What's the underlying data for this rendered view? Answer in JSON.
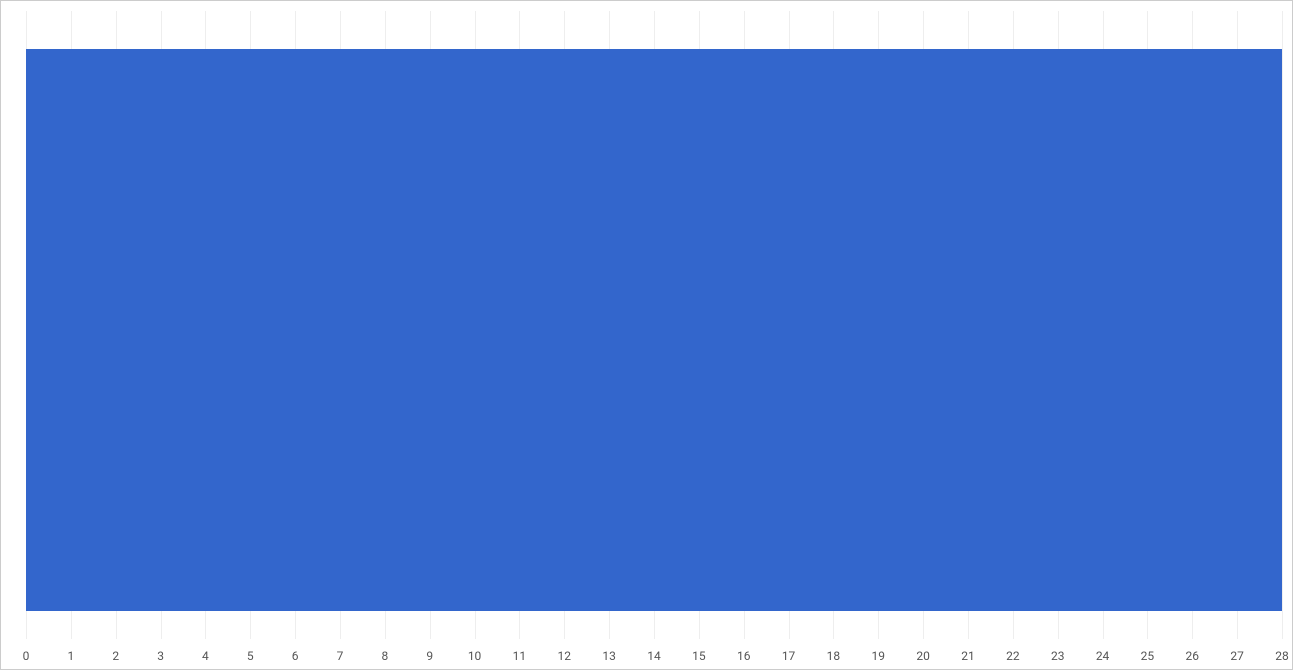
{
  "chart_data": {
    "type": "bar",
    "orientation": "horizontal",
    "categories": [
      ""
    ],
    "values": [
      28
    ],
    "title": "",
    "xlabel": "",
    "ylabel": "",
    "xlim": [
      0,
      28
    ],
    "x_ticks": [
      0,
      1,
      2,
      3,
      4,
      5,
      6,
      7,
      8,
      9,
      10,
      11,
      12,
      13,
      14,
      15,
      16,
      17,
      18,
      19,
      20,
      21,
      22,
      23,
      24,
      25,
      26,
      27,
      28
    ],
    "bar_color": "#3366cc"
  }
}
